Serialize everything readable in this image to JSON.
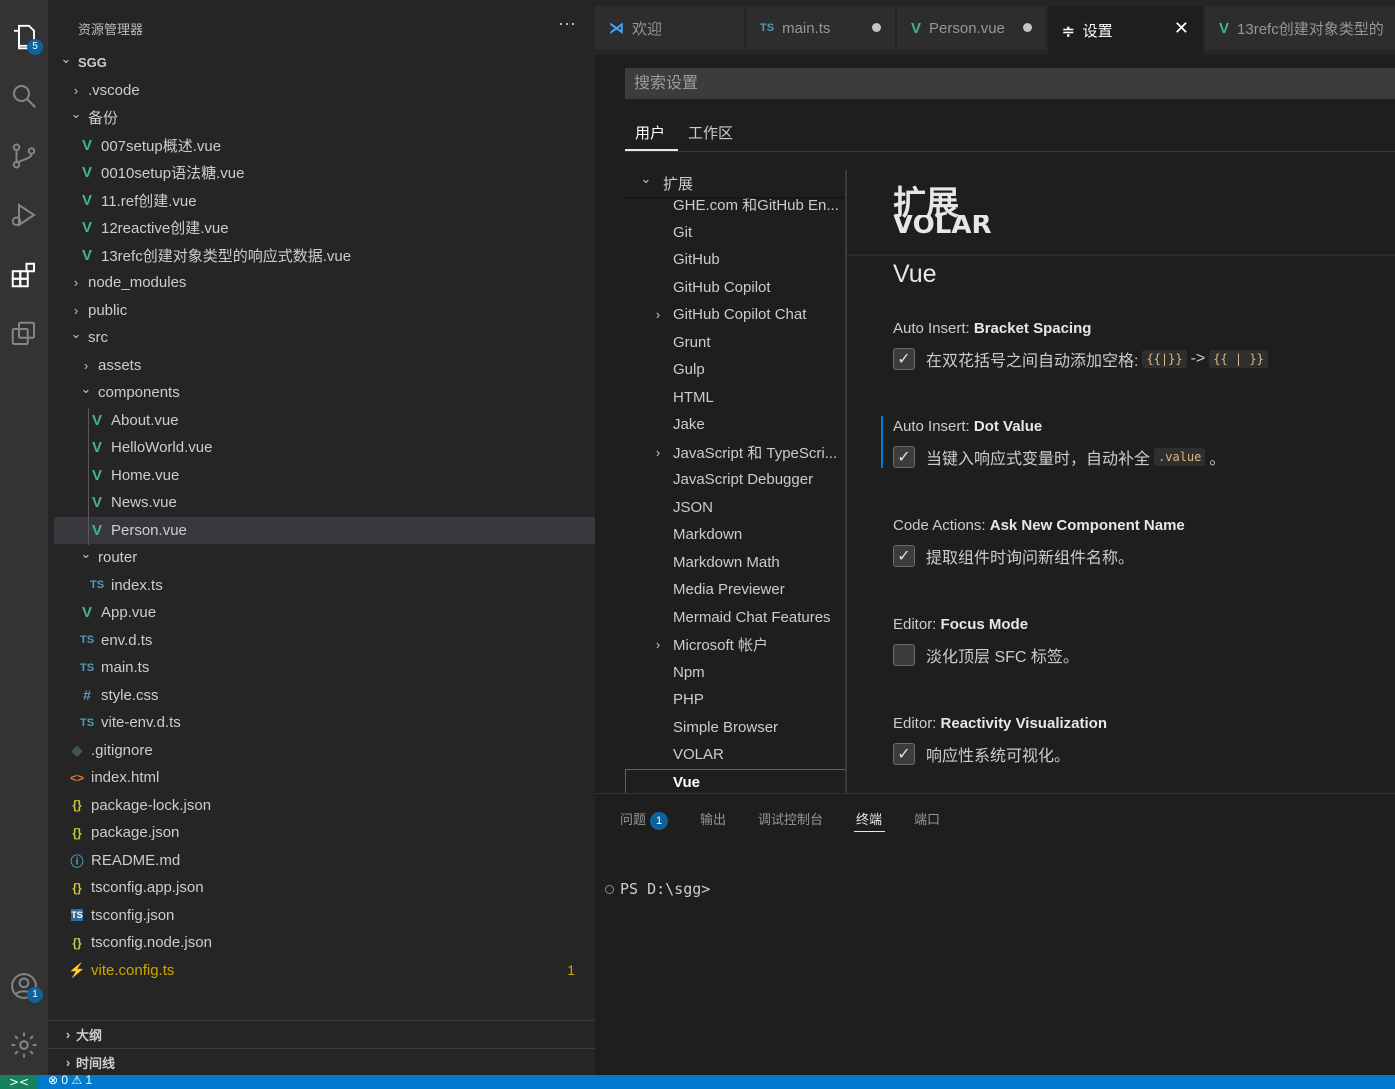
{
  "activity": {
    "explorer_badge": "5",
    "accounts_badge": "1"
  },
  "sidebar": {
    "title": "资源管理器",
    "more": "···",
    "rows": [
      {
        "label": "SGG",
        "kind": "root",
        "indent": 0,
        "twisty": "open"
      },
      {
        "label": ".vscode",
        "kind": "folder",
        "indent": 1,
        "twisty": "closed"
      },
      {
        "label": "备份",
        "kind": "folder",
        "indent": 1,
        "twisty": "open"
      },
      {
        "label": "007setup概述.vue",
        "kind": "vue",
        "indent": 2
      },
      {
        "label": "0010setup语法糖.vue",
        "kind": "vue",
        "indent": 2
      },
      {
        "label": "11.ref创建.vue",
        "kind": "vue",
        "indent": 2
      },
      {
        "label": "12reactive创建.vue",
        "kind": "vue",
        "indent": 2
      },
      {
        "label": "13refc创建对象类型的响应式数据.vue",
        "kind": "vue",
        "indent": 2
      },
      {
        "label": "node_modules",
        "kind": "folder",
        "indent": 1,
        "twisty": "closed"
      },
      {
        "label": "public",
        "kind": "folder",
        "indent": 1,
        "twisty": "closed"
      },
      {
        "label": "src",
        "kind": "folder",
        "indent": 1,
        "twisty": "open"
      },
      {
        "label": "assets",
        "kind": "folder",
        "indent": 2,
        "twisty": "closed"
      },
      {
        "label": "components",
        "kind": "folder",
        "indent": 2,
        "twisty": "open"
      },
      {
        "label": "About.vue",
        "kind": "vue",
        "indent": 3
      },
      {
        "label": "HelloWorld.vue",
        "kind": "vue",
        "indent": 3
      },
      {
        "label": "Home.vue",
        "kind": "vue",
        "indent": 3
      },
      {
        "label": "News.vue",
        "kind": "vue",
        "indent": 3
      },
      {
        "label": "Person.vue",
        "kind": "vue",
        "indent": 3,
        "selected": true
      },
      {
        "label": "router",
        "kind": "folder",
        "indent": 2,
        "twisty": "open"
      },
      {
        "label": "index.ts",
        "kind": "ts",
        "indent": 3
      },
      {
        "label": "App.vue",
        "kind": "vue",
        "indent": 2
      },
      {
        "label": "env.d.ts",
        "kind": "ts",
        "indent": 2
      },
      {
        "label": "main.ts",
        "kind": "ts",
        "indent": 2
      },
      {
        "label": "style.css",
        "kind": "css",
        "indent": 2
      },
      {
        "label": "vite-env.d.ts",
        "kind": "ts",
        "indent": 2
      },
      {
        "label": ".gitignore",
        "kind": "git",
        "indent": 1
      },
      {
        "label": "index.html",
        "kind": "html",
        "indent": 1
      },
      {
        "label": "package-lock.json",
        "kind": "json",
        "indent": 1
      },
      {
        "label": "package.json",
        "kind": "json",
        "indent": 1
      },
      {
        "label": "README.md",
        "kind": "md",
        "indent": 1
      },
      {
        "label": "tsconfig.app.json",
        "kind": "json",
        "indent": 1
      },
      {
        "label": "tsconfig.json",
        "kind": "tsc",
        "indent": 1
      },
      {
        "label": "tsconfig.node.json",
        "kind": "json",
        "indent": 1
      },
      {
        "label": "vite.config.ts",
        "kind": "vite",
        "indent": 1,
        "badge": "1",
        "warn": true
      }
    ],
    "outline": "大纲",
    "timeline": "时间线"
  },
  "icons": {
    "vue": "V",
    "ts": "TS",
    "json": "{}",
    "css": "#",
    "html": "<>",
    "git": "◆",
    "md": "ⓘ",
    "tsc": "TS",
    "vite": "⚡"
  },
  "tabs": [
    {
      "label": "欢迎",
      "icon": "vscode-icon"
    },
    {
      "label": "main.ts",
      "icon": "TS",
      "dirty": true
    },
    {
      "label": "Person.vue",
      "icon": "V",
      "dirty": true
    },
    {
      "label": "设置",
      "icon": "≑",
      "active": true
    },
    {
      "label": "13refc创建对象类型的",
      "icon": "V"
    }
  ],
  "settings": {
    "search_placeholder": "搜索设置",
    "scope_tabs": [
      "用户",
      "工作区"
    ],
    "toc": [
      {
        "label": "扩展",
        "twisty": "open",
        "level": 0
      },
      {
        "label": "GHE.com 和GitHub En...",
        "level": 1
      },
      {
        "label": "Git",
        "level": 1
      },
      {
        "label": "GitHub",
        "level": 1
      },
      {
        "label": "GitHub Copilot",
        "level": 1
      },
      {
        "label": "GitHub Copilot Chat",
        "level": 1,
        "twisty": "closed"
      },
      {
        "label": "Grunt",
        "level": 1
      },
      {
        "label": "Gulp",
        "level": 1
      },
      {
        "label": "HTML",
        "level": 1
      },
      {
        "label": "Jake",
        "level": 1
      },
      {
        "label": "JavaScript 和 TypeScri...",
        "level": 1,
        "twisty": "closed"
      },
      {
        "label": "JavaScript Debugger",
        "level": 1
      },
      {
        "label": "JSON",
        "level": 1
      },
      {
        "label": "Markdown",
        "level": 1
      },
      {
        "label": "Markdown Math",
        "level": 1
      },
      {
        "label": "Media Previewer",
        "level": 1
      },
      {
        "label": "Mermaid Chat Features",
        "level": 1
      },
      {
        "label": "Microsoft 帐户",
        "level": 1,
        "twisty": "closed"
      },
      {
        "label": "Npm",
        "level": 1
      },
      {
        "label": "PHP",
        "level": 1
      },
      {
        "label": "Simple Browser",
        "level": 1
      },
      {
        "label": "VOLAR",
        "level": 1
      },
      {
        "label": "Vue",
        "level": 1,
        "selected": true
      }
    ],
    "section_title": "扩展",
    "section_under": "VOLAR",
    "group_title": "Vue",
    "items": [
      {
        "prefix": "Auto Insert: ",
        "name": "Bracket Spacing",
        "desc": "在双花括号之间自动添加空格:",
        "code1": "{{|}}",
        "arrow": "->",
        "code2": "{{ | }}",
        "desc_end": "",
        "checked": true
      },
      {
        "prefix": "Auto Insert: ",
        "name": "Dot Value",
        "desc": "当键入响应式变量时，自动补全",
        "code1": ".value",
        "desc_end": "。",
        "checked": true,
        "focused": true
      },
      {
        "prefix": "Code Actions: ",
        "name": "Ask New Component Name",
        "desc": "提取组件时询问新组件名称。",
        "checked": true
      },
      {
        "prefix": "Editor: ",
        "name": "Focus Mode",
        "desc": "淡化顶层 SFC 标签。",
        "checked": false
      },
      {
        "prefix": "Editor: ",
        "name": "Reactivity Visualization",
        "desc": "响应性系统可视化。",
        "checked": true
      }
    ]
  },
  "panel": {
    "tabs": [
      {
        "label": "问题",
        "badge": "1"
      },
      {
        "label": "输出"
      },
      {
        "label": "调试控制台"
      },
      {
        "label": "终端",
        "active": true
      },
      {
        "label": "端口"
      }
    ],
    "terminal_prompt": "PS D:\\sgg>"
  },
  "status": {
    "remote": "><",
    "errors": "0",
    "warnings": "1"
  }
}
